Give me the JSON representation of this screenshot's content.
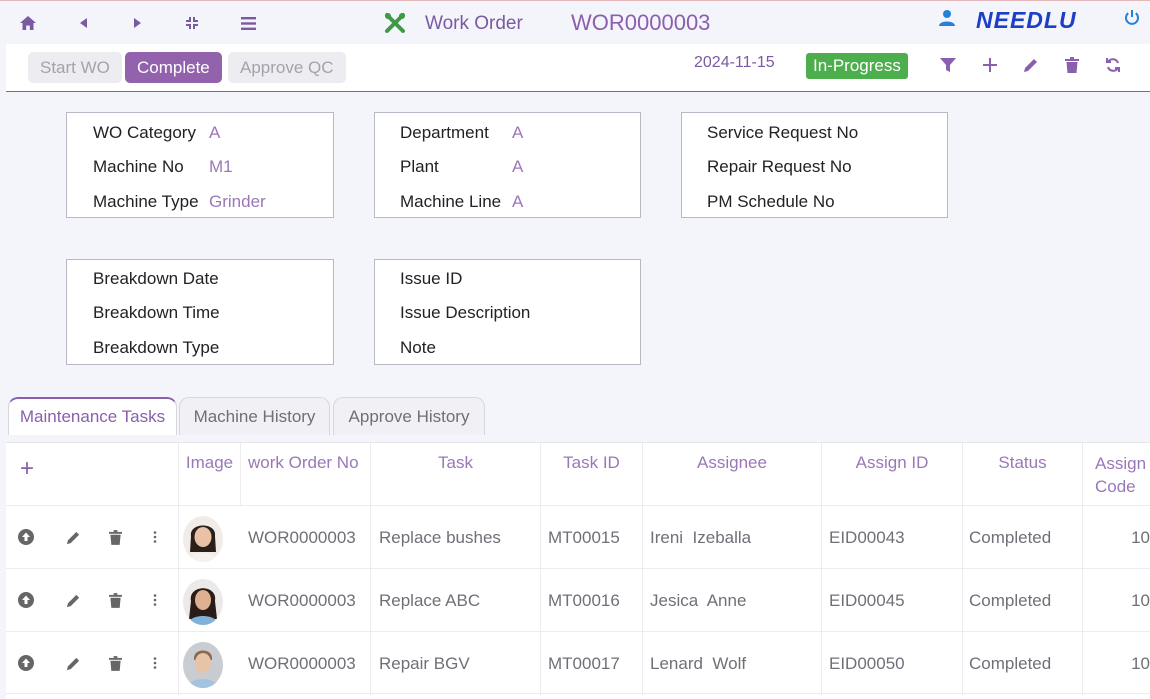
{
  "header": {
    "title": "Work Order",
    "work_order_no": "WOR0000003",
    "logo_text": "NEEDLU",
    "accent_color": "#8a5fae"
  },
  "nav_icons": [
    "home-icon",
    "chevron-left-icon",
    "chevron-right-icon",
    "collapse-icon",
    "menu-icon"
  ],
  "toolbar": {
    "workflow_buttons": [
      {
        "label": "Start WO",
        "state": "disabled"
      },
      {
        "label": "Complete",
        "state": "active"
      },
      {
        "label": "Approve QC",
        "state": "disabled"
      }
    ],
    "date": "2024-11-15",
    "status": "In-Progress",
    "tools": [
      "filter-icon",
      "add-icon",
      "edit-icon",
      "delete-icon",
      "refresh-icon"
    ]
  },
  "panels": [
    {
      "fields": [
        {
          "label": "WO Category",
          "value": "A"
        },
        {
          "label": "Machine No",
          "value": "M1"
        },
        {
          "label": "Machine Type",
          "value": "Grinder"
        }
      ]
    },
    {
      "fields": [
        {
          "label": "Department",
          "value": "A"
        },
        {
          "label": "Plant",
          "value": "A"
        },
        {
          "label": "Machine Line",
          "value": "A"
        }
      ]
    },
    {
      "fields": [
        {
          "label": "Service Request No",
          "value": ""
        },
        {
          "label": "Repair Request No",
          "value": ""
        },
        {
          "label": "PM Schedule No",
          "value": ""
        }
      ]
    },
    {
      "fields": [
        {
          "label": "Breakdown Date",
          "value": ""
        },
        {
          "label": "Breakdown Time",
          "value": ""
        },
        {
          "label": "Breakdown Type",
          "value": ""
        }
      ]
    },
    {
      "fields": [
        {
          "label": "Issue ID",
          "value": ""
        },
        {
          "label": "Issue Description",
          "value": ""
        },
        {
          "label": "Note",
          "value": ""
        }
      ]
    }
  ],
  "tabs": [
    {
      "label": "Maintenance Tasks",
      "active": true
    },
    {
      "label": "Machine History",
      "active": false
    },
    {
      "label": "Approve History",
      "active": false
    }
  ],
  "grid": {
    "add_label": "+",
    "columns": [
      "Image",
      "work Order No",
      "Task",
      "Task ID",
      "Assignee",
      "Assign ID",
      "Status",
      "Assign Code"
    ],
    "rows": [
      {
        "wo": "WOR0000003",
        "task": "Replace bushes",
        "task_id": "MT00015",
        "assignee": "Ireni  Izeballa",
        "assign_id": "EID00043",
        "status": "Completed",
        "code": "10"
      },
      {
        "wo": "WOR0000003",
        "task": "Replace ABC",
        "task_id": "MT00016",
        "assignee": "Jesica  Anne",
        "assign_id": "EID00045",
        "status": "Completed",
        "code": "10"
      },
      {
        "wo": "WOR0000003",
        "task": "Repair BGV",
        "task_id": "MT00017",
        "assignee": "Lenard  Wolf",
        "assign_id": "EID00050",
        "status": "Completed",
        "code": "10"
      }
    ]
  }
}
